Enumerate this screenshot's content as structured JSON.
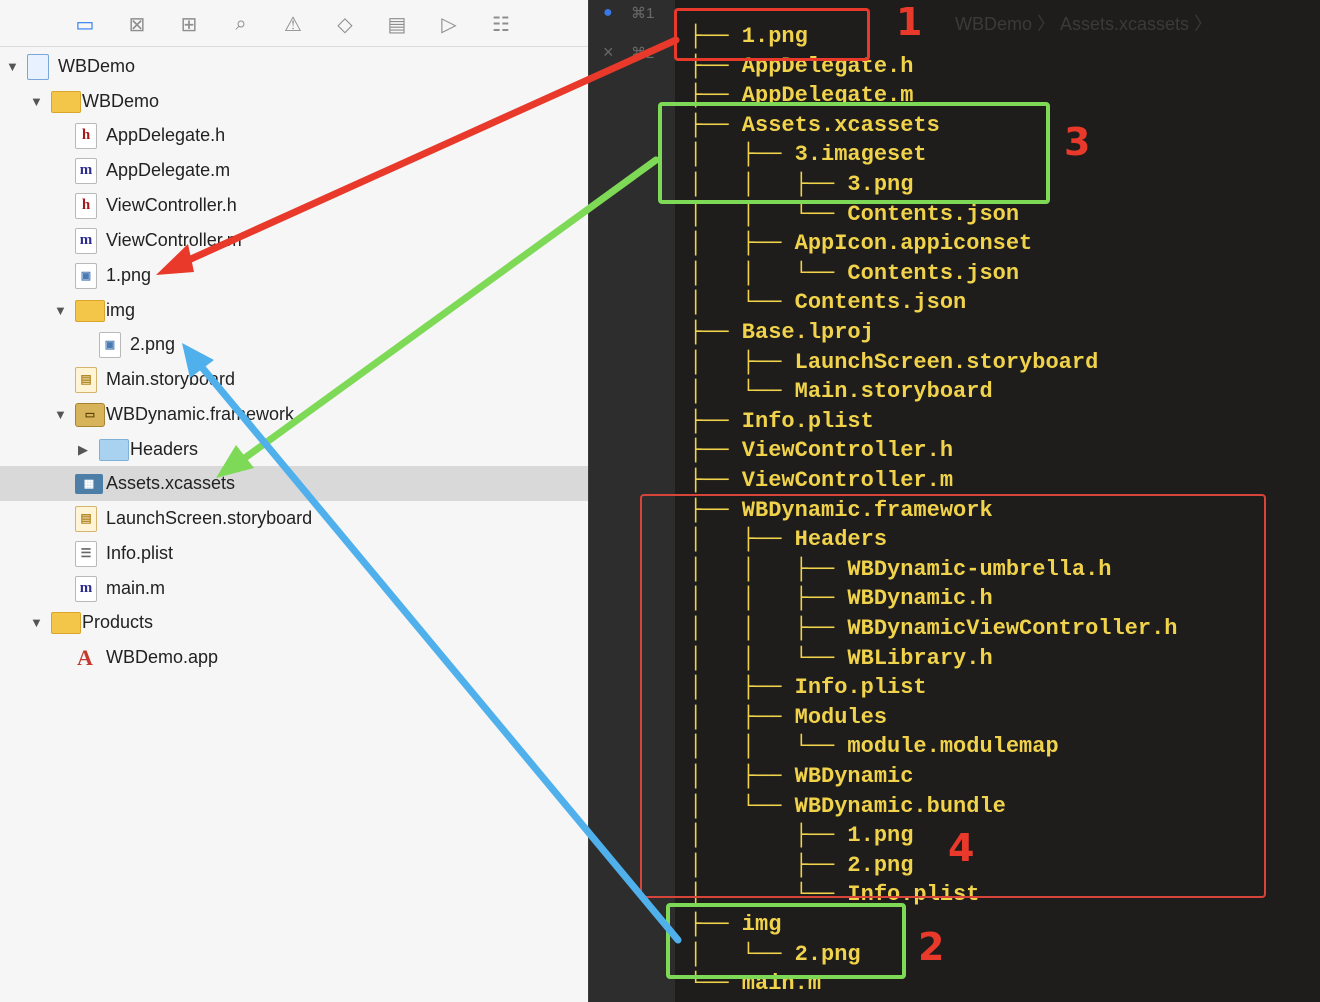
{
  "navigator": {
    "toolbar_icons": [
      "folder-icon",
      "source-control-icon",
      "hierarchy-icon",
      "search-icon",
      "warning-icon",
      "test-icon",
      "debug-icon",
      "breakpoint-icon",
      "report-icon"
    ],
    "rows": [
      {
        "label": "WBDemo",
        "icon": "project-icon",
        "kind": "proj",
        "glyph": "",
        "triangle": "▼",
        "indent": 0
      },
      {
        "label": "WBDemo",
        "icon": "folder-icon",
        "kind": "folder",
        "glyph": "",
        "triangle": "▼",
        "indent": 1
      },
      {
        "label": "AppDelegate.h",
        "icon": "header-file-icon",
        "kind": "file h",
        "glyph": "h",
        "triangle": "",
        "indent": 2
      },
      {
        "label": "AppDelegate.m",
        "icon": "objc-file-icon",
        "kind": "file m",
        "glyph": "m",
        "triangle": "",
        "indent": 2
      },
      {
        "label": "ViewController.h",
        "icon": "header-file-icon",
        "kind": "file h",
        "glyph": "h",
        "triangle": "",
        "indent": 2
      },
      {
        "label": "ViewController.m",
        "icon": "objc-file-icon",
        "kind": "file m",
        "glyph": "m",
        "triangle": "",
        "indent": 2
      },
      {
        "label": "1.png",
        "icon": "image-file-icon",
        "kind": "file png",
        "glyph": "▣",
        "triangle": "",
        "indent": 2
      },
      {
        "label": "img",
        "icon": "folder-icon",
        "kind": "folder",
        "glyph": "",
        "triangle": "▼",
        "indent": 2
      },
      {
        "label": "2.png",
        "icon": "image-file-icon",
        "kind": "file png",
        "glyph": "▣",
        "triangle": "",
        "indent": 3
      },
      {
        "label": "Main.storyboard",
        "icon": "storyboard-icon",
        "kind": "sb",
        "glyph": "▤",
        "triangle": "",
        "indent": 2
      },
      {
        "label": "WBDynamic.framework",
        "icon": "framework-icon",
        "kind": "fw",
        "glyph": "▭",
        "triangle": "▼",
        "indent": 2
      },
      {
        "label": "Headers",
        "icon": "folder-icon",
        "kind": "folder blue",
        "glyph": "",
        "triangle": "▶",
        "indent": 3
      },
      {
        "label": "Assets.xcassets",
        "icon": "asset-catalog-icon",
        "kind": "xca",
        "glyph": "▦",
        "triangle": "",
        "indent": 2
      },
      {
        "label": "LaunchScreen.storyboard",
        "icon": "storyboard-icon",
        "kind": "sb",
        "glyph": "▤",
        "triangle": "",
        "indent": 2
      },
      {
        "label": "Info.plist",
        "icon": "plist-icon",
        "kind": "plist",
        "glyph": "☰",
        "triangle": "",
        "indent": 2
      },
      {
        "label": "main.m",
        "icon": "objc-file-icon",
        "kind": "file m",
        "glyph": "m",
        "triangle": "",
        "indent": 2
      },
      {
        "label": "Products",
        "icon": "folder-icon",
        "kind": "folder",
        "glyph": "",
        "triangle": "▼",
        "indent": 1
      },
      {
        "label": "WBDemo.app",
        "icon": "app-icon",
        "kind": "app",
        "glyph": "A",
        "triangle": "",
        "indent": 2
      }
    ],
    "selected_label": "Assets.xcassets"
  },
  "gutter": {
    "tab1": "⌘1",
    "tab2": "⌘2",
    "close": "×"
  },
  "terminal": {
    "breadcrumb": "WBDemo 〉 Assets.xcassets 〉",
    "lines": [
      "├── 1.png",
      "├── AppDelegate.h",
      "├── AppDelegate.m",
      "├── Assets.xcassets",
      "│   ├── 3.imageset",
      "│   │   ├── 3.png",
      "│   │   └── Contents.json",
      "│   ├── AppIcon.appiconset",
      "│   │   └── Contents.json",
      "│   └── Contents.json",
      "├── Base.lproj",
      "│   ├── LaunchScreen.storyboard",
      "│   └── Main.storyboard",
      "├── Info.plist",
      "├── ViewController.h",
      "├── ViewController.m",
      "├── WBDynamic.framework",
      "│   ├── Headers",
      "│   │   ├── WBDynamic-umbrella.h",
      "│   │   ├── WBDynamic.h",
      "│   │   ├── WBDynamicViewController.h",
      "│   │   └── WBLibrary.h",
      "│   ├── Info.plist",
      "│   ├── Modules",
      "│   │   └── module.modulemap",
      "│   ├── WBDynamic",
      "│   └── WBDynamic.bundle",
      "│       ├── 1.png",
      "│       ├── 2.png",
      "│       └── Info.plist",
      "├── img",
      "│   └── 2.png",
      "└── main.m"
    ]
  },
  "annotations": {
    "labels": [
      "1",
      "2",
      "3",
      "4"
    ],
    "colors": {
      "red": "#e8392b",
      "green": "#7ed957",
      "blue": "#4fb0ec",
      "red_box": "#d6443a"
    }
  }
}
